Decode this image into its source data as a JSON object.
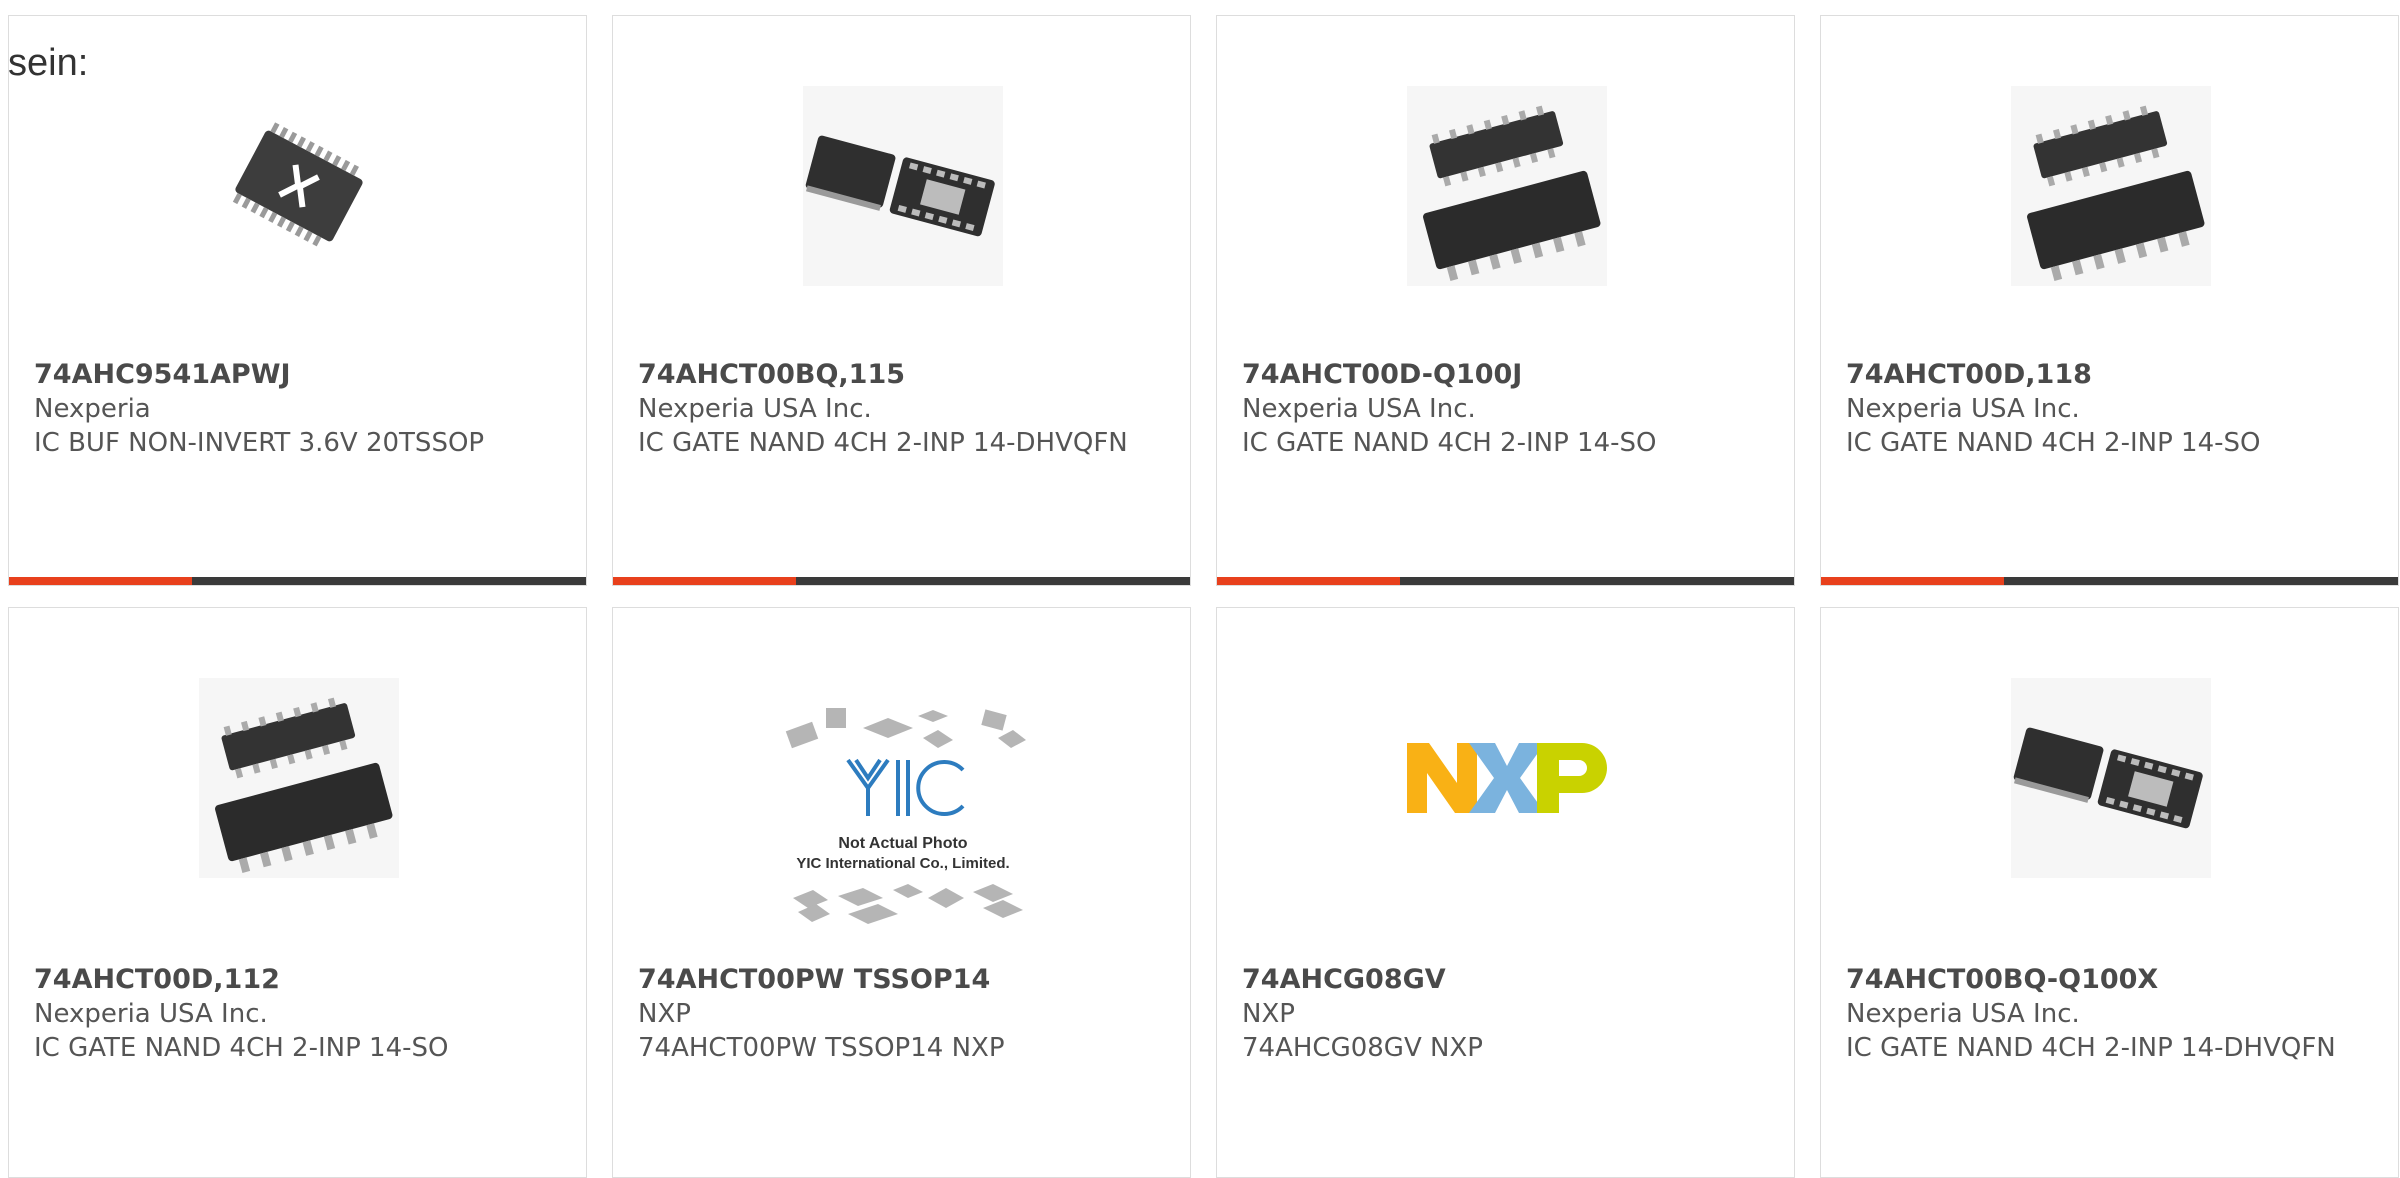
{
  "heading": "sein:",
  "colors": {
    "accent": "#e8401c",
    "bar": "#3a3a3a"
  },
  "products": [
    {
      "part": "74AHC9541APWJ",
      "manufacturer": "Nexperia",
      "description": "IC BUF NON-INVERT 3.6V 20TSSOP",
      "image": "nexperia-tssop-chip-icon"
    },
    {
      "part": "74AHCT00BQ,115",
      "manufacturer": "Nexperia USA Inc.",
      "description": "IC GATE NAND 4CH 2-INP 14-DHVQFN",
      "image": "dhvqfn-chip-icon"
    },
    {
      "part": "74AHCT00D-Q100J",
      "manufacturer": "Nexperia USA Inc.",
      "description": "IC GATE NAND 4CH 2-INP 14-SO",
      "image": "so14-chip-icon"
    },
    {
      "part": "74AHCT00D,118",
      "manufacturer": "Nexperia USA Inc.",
      "description": "IC GATE NAND 4CH 2-INP 14-SO",
      "image": "so14-chip-icon"
    },
    {
      "part": "74AHCT00D,112",
      "manufacturer": "Nexperia USA Inc.",
      "description": "IC GATE NAND 4CH 2-INP 14-SO",
      "image": "so14-chip-icon"
    },
    {
      "part": "74AHCT00PW TSSOP14",
      "manufacturer": "NXP",
      "description": "74AHCT00PW TSSOP14 NXP",
      "image": "yic-placeholder-icon",
      "image_text": [
        "Not Actual Photo",
        "YIC International Co., Limited."
      ]
    },
    {
      "part": "74AHCG08GV",
      "manufacturer": "NXP",
      "description": "74AHCG08GV NXP",
      "image": "nxp-logo-icon",
      "logo_colors": [
        "#f9b115",
        "#7bb3de",
        "#c9d200"
      ]
    },
    {
      "part": "74AHCT00BQ-Q100X",
      "manufacturer": "Nexperia USA Inc.",
      "description": "IC GATE NAND 4CH 2-INP 14-DHVQFN",
      "image": "dhvqfn-chip-icon"
    }
  ]
}
